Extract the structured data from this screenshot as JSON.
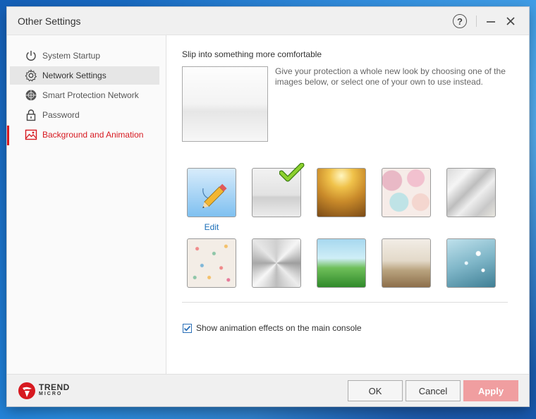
{
  "window": {
    "title": "Other Settings",
    "help_glyph": "?"
  },
  "sidebar": {
    "items": [
      {
        "label": "System Startup",
        "icon": "power-icon"
      },
      {
        "label": "Network Settings",
        "icon": "gear-icon"
      },
      {
        "label": "Smart Protection Network",
        "icon": "globe-icon"
      },
      {
        "label": "Password",
        "icon": "lock-icon"
      },
      {
        "label": "Background and Animation",
        "icon": "picture-icon"
      }
    ],
    "active_index": 4,
    "hover_index": 1
  },
  "main": {
    "heading": "Slip into something more comfortable",
    "description": "Give your protection a whole new look by choosing one of the images below, or select one of your own to use instead.",
    "edit_label": "Edit",
    "thumbnails": [
      {
        "name": "edit",
        "selected": false
      },
      {
        "name": "white-mist",
        "selected": true
      },
      {
        "name": "golden-wheat",
        "selected": false
      },
      {
        "name": "pastel-circles",
        "selected": false
      },
      {
        "name": "grey-polygon",
        "selected": false
      },
      {
        "name": "confetti-dots",
        "selected": false
      },
      {
        "name": "brushed-metal",
        "selected": false
      },
      {
        "name": "green-grass",
        "selected": false
      },
      {
        "name": "sandy-beach",
        "selected": false
      },
      {
        "name": "frosty-branches",
        "selected": false
      }
    ],
    "animation_checkbox": {
      "label": "Show animation effects on the main console",
      "checked": true
    }
  },
  "footer": {
    "logo_line1": "TREND",
    "logo_line2": "MICRO",
    "ok_label": "OK",
    "cancel_label": "Cancel",
    "apply_label": "Apply"
  },
  "colors": {
    "accent": "#d71920",
    "link": "#1a6eb8",
    "apply_disabled": "#f09ea0"
  }
}
